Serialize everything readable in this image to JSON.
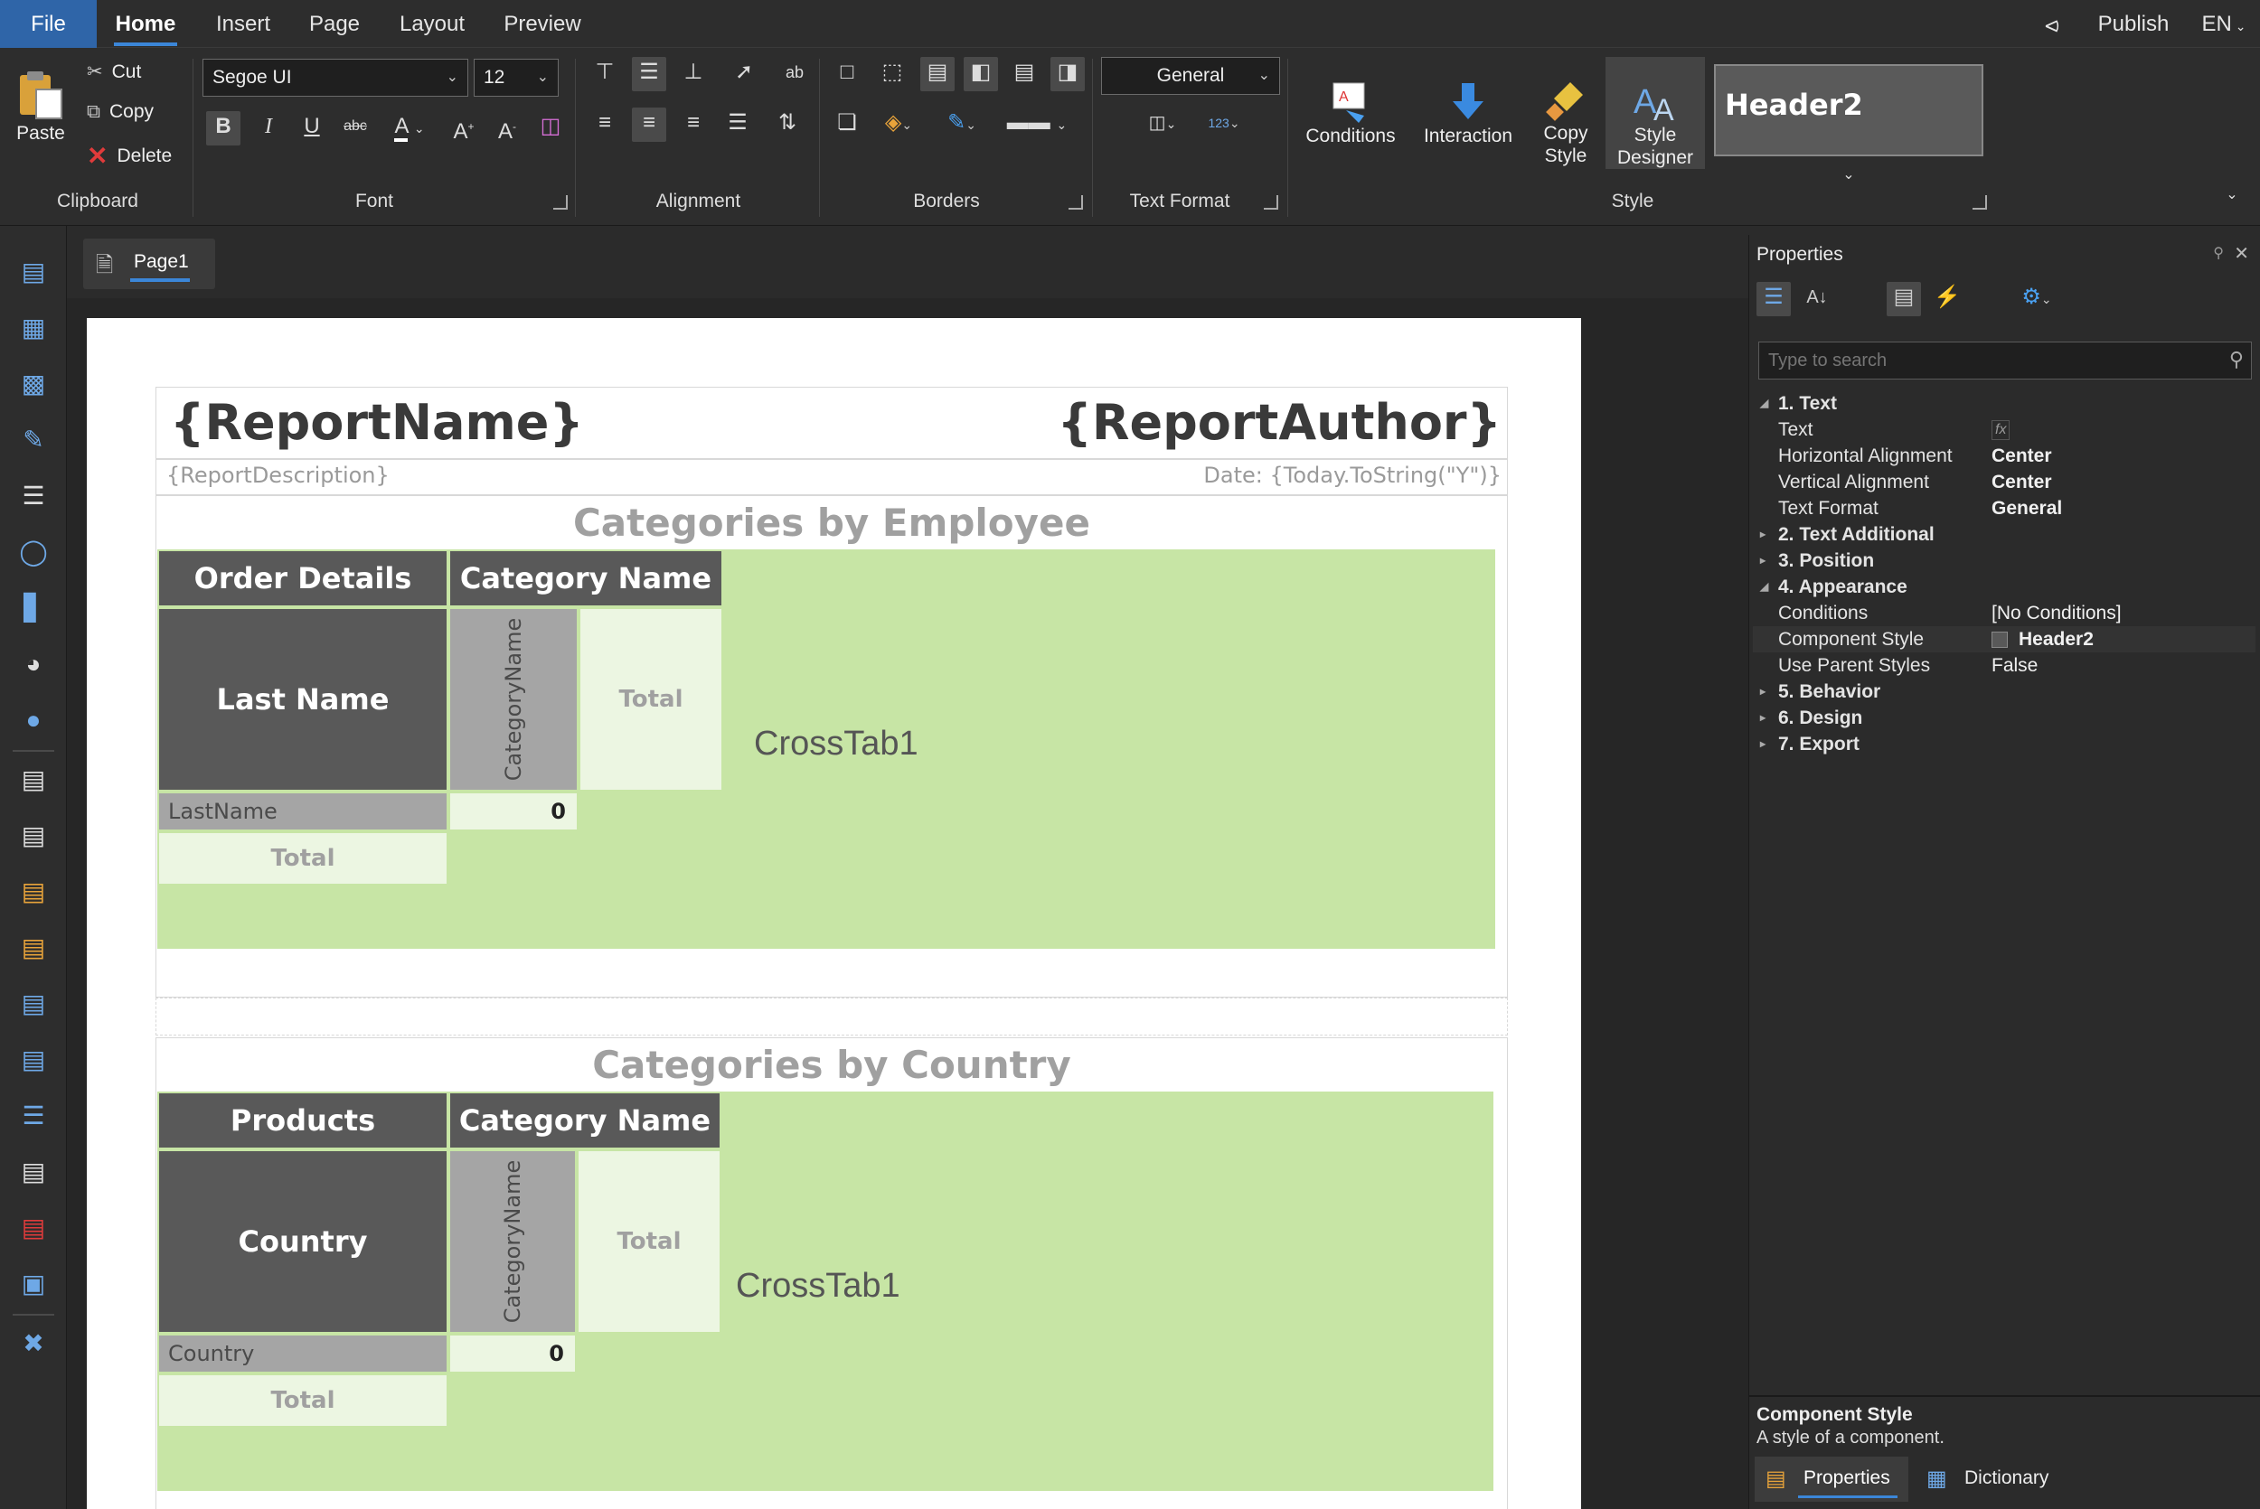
{
  "menu": {
    "file": "File",
    "home": "Home",
    "insert": "Insert",
    "page": "Page",
    "layout": "Layout",
    "preview": "Preview",
    "publish": "Publish",
    "lang": "EN"
  },
  "clipboard": {
    "paste": "Paste",
    "cut": "Cut",
    "copy": "Copy",
    "delete": "Delete",
    "label": "Clipboard"
  },
  "font": {
    "family": "Segoe UI",
    "size": "12",
    "label": "Font"
  },
  "alignment": {
    "label": "Alignment"
  },
  "borders": {
    "label": "Borders"
  },
  "text_format": {
    "value": "General",
    "label": "Text Format"
  },
  "style": {
    "conditions": "Conditions",
    "interaction": "Interaction",
    "copy_style_1": "Copy",
    "copy_style_2": "Style",
    "style_designer_1": "Style",
    "style_designer_2": "Designer",
    "preview_name": "Header2",
    "label": "Style"
  },
  "page_tab": "Page1",
  "report": {
    "name": "{ReportName}",
    "author": "{ReportAuthor}",
    "description": "{ReportDescription}",
    "date": "Date: {Today.ToString(\"Y\")}",
    "section1": {
      "title": "Categories by Employee",
      "h1": "Order Details",
      "h2": "Category Name",
      "row_header": "Last Name",
      "col_field": "CategoryName",
      "total": "Total",
      "row_field": "LastName",
      "value": "0",
      "row_total": "Total",
      "crosstab": "CrossTab1"
    },
    "section2": {
      "title": "Categories by Country",
      "h1": "Products",
      "h2": "Category Name",
      "row_header": "Country",
      "col_field": "CategoryName",
      "total": "Total",
      "row_field": "Country",
      "value": "0",
      "row_total": "Total",
      "crosstab": "CrossTab1"
    }
  },
  "properties": {
    "title": "Properties",
    "search_placeholder": "Type to search",
    "cat1": "1. Text",
    "text_k": "Text",
    "text_v": "fx",
    "halign_k": "Horizontal Alignment",
    "halign_v": "Center",
    "valign_k": "Vertical Alignment",
    "valign_v": "Center",
    "tformat_k": "Text Format",
    "tformat_v": "General",
    "cat2": "2. Text  Additional",
    "cat3": "3. Position",
    "cat4": "4. Appearance",
    "cond_k": "Conditions",
    "cond_v": "[No Conditions]",
    "cstyle_k": "Component Style",
    "cstyle_v": "Header2",
    "parent_k": "Use Parent Styles",
    "parent_v": "False",
    "cat5": "5. Behavior",
    "cat6": "6. Design",
    "cat7": "7. Export",
    "desc_title": "Component Style",
    "desc_text": "A style of a component.",
    "tab_props": "Properties",
    "tab_dict": "Dictionary"
  },
  "colors": {
    "accent": "#3b86d8",
    "file_bg": "#2f65a8",
    "crosstab_bg": "#c7e5a5",
    "header_cell": "#595959",
    "field_cell": "#a5a5a5",
    "total_cell": "#ecf6e2"
  }
}
